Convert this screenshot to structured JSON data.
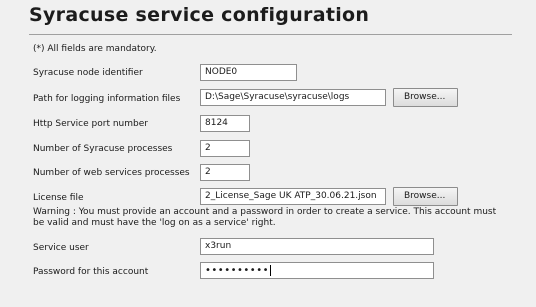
{
  "title": "Syracuse service configuration",
  "mandatory_note": "(*) All fields are mandatory.",
  "fields": [
    {
      "label": "Syracuse node identifier",
      "value": "NODE0"
    },
    {
      "label": "Path for logging information files",
      "value": "D:\\Sage\\Syracuse\\syracuse\\logs",
      "button": "Browse..."
    },
    {
      "label": "Http Service port number",
      "value": "8124"
    },
    {
      "label": "Number of Syracuse processes",
      "value": "2"
    },
    {
      "label": "Number of web services processes",
      "value": "2"
    },
    {
      "label": "License file",
      "value": "2_License_Sage UK ATP_30.06.21.json",
      "button": "Browse..."
    }
  ],
  "warning": "Warning : You must provide an account and a password in order to create a service. This account must be valid and must have the 'log on as a service' right.",
  "service_user": {
    "label": "Service user",
    "value": "x3run"
  },
  "password": {
    "label": "Password for this account",
    "value": "••••••••••"
  }
}
